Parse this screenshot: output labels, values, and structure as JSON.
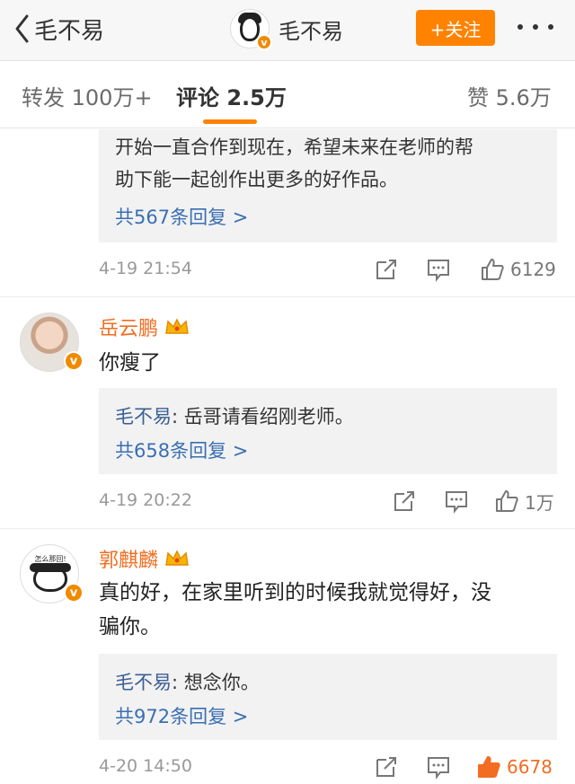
{
  "header": {
    "back_label": "毛不易",
    "title": "毛不易",
    "follow_label": "+关注"
  },
  "tabs": {
    "repost": {
      "label": "转发",
      "count": "100万+"
    },
    "comments": {
      "label": "评论",
      "count": "2.5万"
    },
    "likes": {
      "label": "赞",
      "count": "5.6万"
    }
  },
  "comments": [
    {
      "reply_text_line1": "开始一直合作到现在，希望未来在老师的帮",
      "reply_text_line2": "助下能一起创作出更多的好作品。",
      "more_replies": "共567条回复 >",
      "time": "4-19 21:54",
      "likes": "6129"
    },
    {
      "name": "岳云鹏",
      "text": "你瘦了",
      "reply_name": "毛不易",
      "reply_text": ": 岳哥请看绍刚老师。",
      "more_replies": "共658条回复 >",
      "time": "4-19 20:22",
      "likes": "1万"
    },
    {
      "name": "郭麒麟",
      "avatar_caption": "怎么那回!",
      "text_line1": "真的好，在家里听到的时候我就觉得好，没",
      "text_line2": "骗你。",
      "reply_name": "毛不易",
      "reply_text": ": 想念你。",
      "more_replies": "共972条回复 >",
      "time": "4-20 14:50",
      "likes": "6678"
    }
  ],
  "colors": {
    "accent": "#ff8200",
    "username": "#f26d21",
    "link": "#3a6fb3",
    "reply_bg": "#f2f2f2"
  },
  "icons": [
    "chevron-left-icon",
    "verified-badge-icon",
    "more-dots-icon",
    "share-icon",
    "comment-icon",
    "thumbs-up-icon",
    "crown-icon"
  ]
}
